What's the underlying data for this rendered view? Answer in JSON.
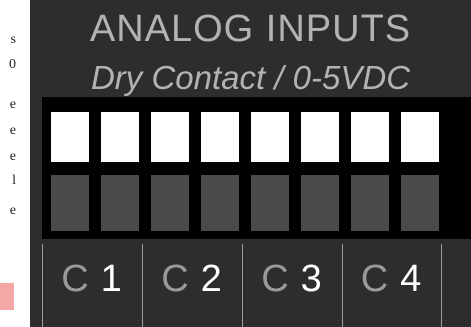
{
  "page_strip": {
    "chars": [
      "s",
      "0",
      "e",
      "e",
      "e",
      "l",
      "e"
    ]
  },
  "panel": {
    "title": "ANALOG INPUTS",
    "subtitle": "Dry Contact / 0-5VDC",
    "switches": [
      {
        "state": "up"
      },
      {
        "state": "up"
      },
      {
        "state": "up"
      },
      {
        "state": "up"
      },
      {
        "state": "up"
      },
      {
        "state": "up"
      },
      {
        "state": "up"
      },
      {
        "state": "up"
      }
    ],
    "channels": [
      {
        "prefix": "C",
        "number": "1"
      },
      {
        "prefix": "C",
        "number": "2"
      },
      {
        "prefix": "C",
        "number": "3"
      },
      {
        "prefix": "C",
        "number": "4"
      }
    ]
  }
}
